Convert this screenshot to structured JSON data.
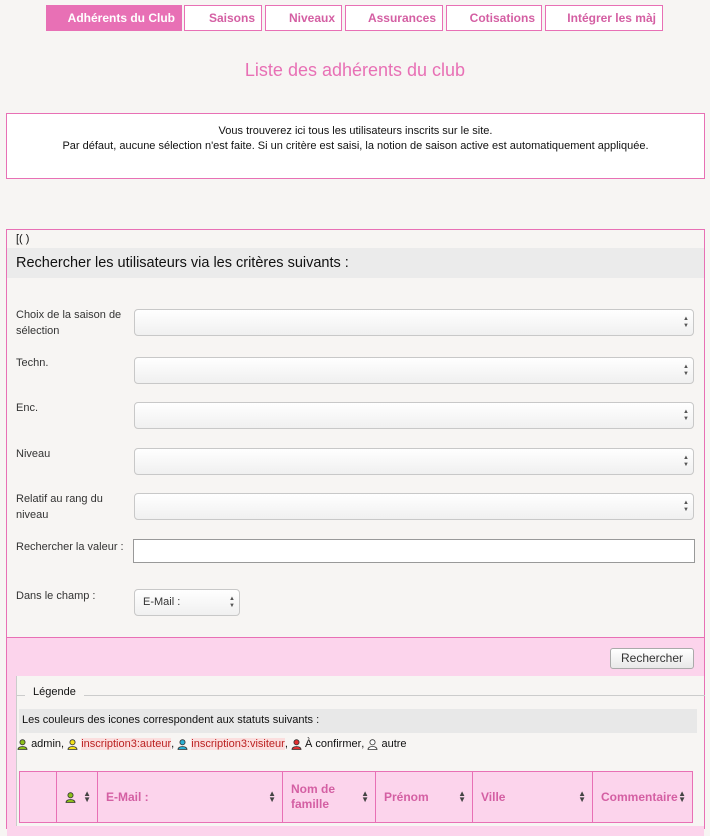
{
  "tabs": [
    {
      "label": "Adhérents du Club",
      "active": true
    },
    {
      "label": "Saisons"
    },
    {
      "label": "Niveaux"
    },
    {
      "label": "Assurances"
    },
    {
      "label": "Cotisations"
    },
    {
      "label": "Intégrer les màj"
    }
  ],
  "page_title": "Liste des adhérents du club",
  "info": {
    "line1": "Vous trouverez ici tous les utilisateurs inscrits sur le site.",
    "line2": "Par défaut, aucune sélection n'est faite. Si un critère est saisi, la notion de saison active est automatiquement appliquée."
  },
  "panel": {
    "bracket_text": "[( )",
    "header": "Rechercher les utilisateurs via les critères suivants :"
  },
  "form": {
    "season_label": "Choix de la saison de sélection",
    "techn_label": "Techn.",
    "enc_label": "Enc.",
    "niveau_label": "Niveau",
    "rang_label": "Relatif au rang du niveau",
    "search_value_label": "Rechercher la valeur :",
    "search_value": "",
    "field_label": "Dans le champ :",
    "field_selected": "E-Mail :"
  },
  "search_button": "Rechercher",
  "legend": {
    "title": "Légende",
    "description": "Les couleurs des icones correspondent aux statuts suivants :",
    "items": [
      {
        "label": "admin",
        "color": "#8cbf1a",
        "highlight": false
      },
      {
        "label": "inscription3:auteur",
        "color": "#f2e21a",
        "highlight": true
      },
      {
        "label": "inscription3:visiteur",
        "color": "#2ab0d4",
        "highlight": true
      },
      {
        "label": "À confirmer",
        "color": "#e23030",
        "highlight": false
      },
      {
        "label": "autre",
        "color": "#ffffff",
        "highlight": false
      }
    ]
  },
  "table": {
    "columns": [
      "",
      "",
      "E-Mail :",
      "Nom de famille",
      "Prénom",
      "Ville",
      "Commentaire"
    ]
  },
  "colors": {
    "accent": "#e870b5",
    "accent_light": "#fcd4ec"
  }
}
